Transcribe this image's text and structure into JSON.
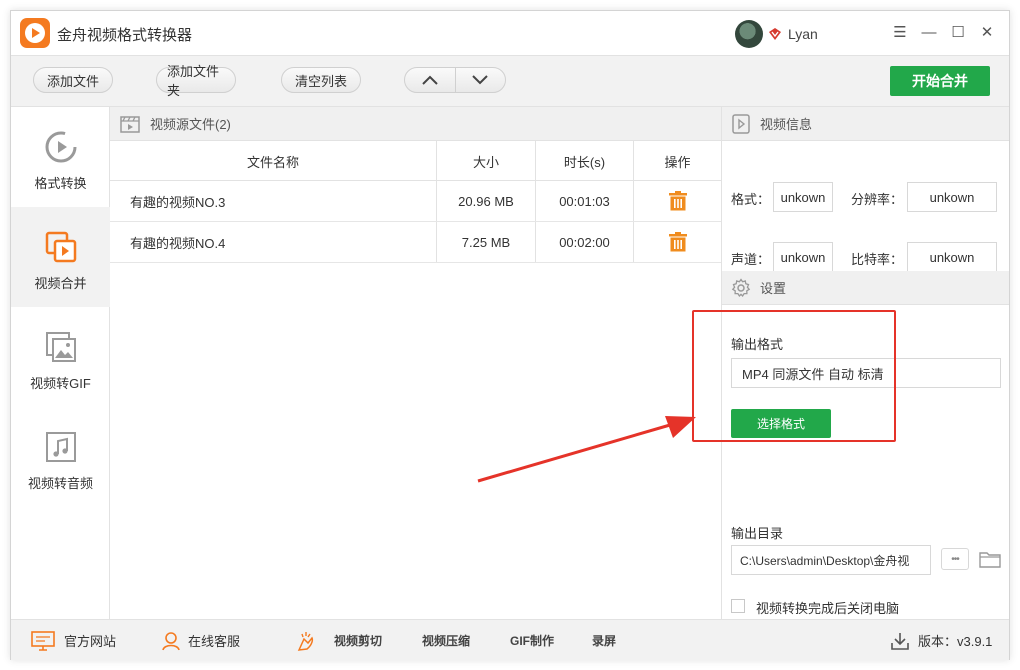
{
  "app": {
    "title": "金舟视频格式转换器",
    "username": "Lyan",
    "colors": {
      "accent": "#22a84a",
      "brand": "#f47a20",
      "trash": "#f08c1e",
      "highlight": "#e53329"
    }
  },
  "window_controls": {
    "menu": "☰",
    "minimize": "—",
    "maximize": "☐",
    "close": "✕"
  },
  "toolbar": {
    "add_file": "添加文件",
    "add_folder": "添加文件夹",
    "clear_list": "清空列表",
    "start_merge": "开始合并"
  },
  "sidebar": {
    "items": [
      {
        "label": "格式转换",
        "icon": "format-convert-icon",
        "active": false
      },
      {
        "label": "视频合并",
        "icon": "video-merge-icon",
        "active": true
      },
      {
        "label": "视频转GIF",
        "icon": "image-icon",
        "active": false
      },
      {
        "label": "视频转音频",
        "icon": "music-icon",
        "active": false
      }
    ]
  },
  "filelist": {
    "section_title": "视频源文件(2)",
    "columns": [
      "文件名称",
      "大小",
      "时长(s)",
      "操作"
    ],
    "rows": [
      {
        "name": "有趣的视频NO.3",
        "size": "20.96 MB",
        "duration": "00:01:03"
      },
      {
        "name": "有趣的视频NO.4",
        "size": "7.25 MB",
        "duration": "00:02:00"
      }
    ]
  },
  "video_info": {
    "section_title": "视频信息",
    "format_label": "格式：",
    "format_value": "unkown",
    "resolution_label": "分辨率：",
    "resolution_value": "unkown",
    "audio_label": "声道：",
    "audio_value": "unkown",
    "bitrate_label": "比特率：",
    "bitrate_value": "unkown"
  },
  "settings": {
    "section_title": "设置",
    "output_format_label": "输出格式",
    "output_format_value": "MP4 同源文件 自动 标清",
    "select_format_button": "选择格式",
    "output_dir_label": "输出目录",
    "output_dir_value": "C:\\Users\\admin\\Desktop\\金舟视",
    "browse_button": "•••",
    "shutdown_label": "视频转换完成后关闭电脑",
    "shutdown_checked": false
  },
  "bottombar": {
    "website": "官方网站",
    "support": "在线客服",
    "video_cut": "视频剪切",
    "video_compress": "视频压缩",
    "gif_make": "GIF制作",
    "screen_record": "录屏",
    "version": "版本：v3.9.1"
  }
}
